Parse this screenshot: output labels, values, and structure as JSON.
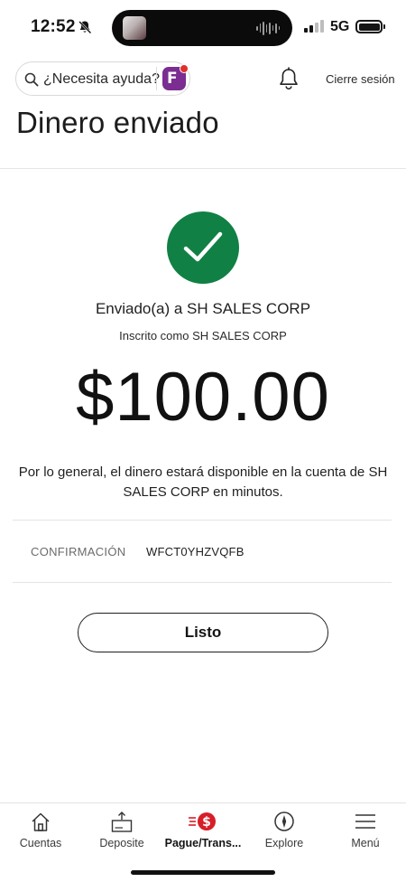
{
  "status_bar": {
    "time": "12:52",
    "network": "5G",
    "icons": [
      "bell-slash-icon",
      "signal-icon",
      "battery-icon"
    ]
  },
  "header": {
    "search_placeholder": "¿Necesita ayuda?",
    "assistant_badge_letter": "F",
    "sign_out_label": "Cierre sesión",
    "page_title": "Dinero enviado"
  },
  "confirmation": {
    "sent_to": "Enviado(a) a SH SALES CORP",
    "enrolled_as": "Inscrito como SH SALES CORP",
    "amount": "$100.00",
    "availability_note": "Por lo general, el dinero estará disponible en la cuenta de SH SALES CORP en minutos.",
    "confirmation_label": "CONFIRMACIÓN",
    "confirmation_code": "WFCT0YHZVQFB",
    "done_label": "Listo"
  },
  "tabbar": {
    "items": [
      {
        "label": "Cuentas",
        "icon": "house-icon"
      },
      {
        "label": "Deposite",
        "icon": "check-deposit-icon"
      },
      {
        "label": "Pague/Trans...",
        "icon": "pay-transfer-icon",
        "active": true
      },
      {
        "label": "Explore",
        "icon": "compass-icon"
      },
      {
        "label": "Menú",
        "icon": "hamburger-menu-icon"
      }
    ]
  },
  "colors": {
    "success_green": "#118045",
    "brand_red": "#d71e28",
    "assistant_purple": "#7b2d92"
  }
}
